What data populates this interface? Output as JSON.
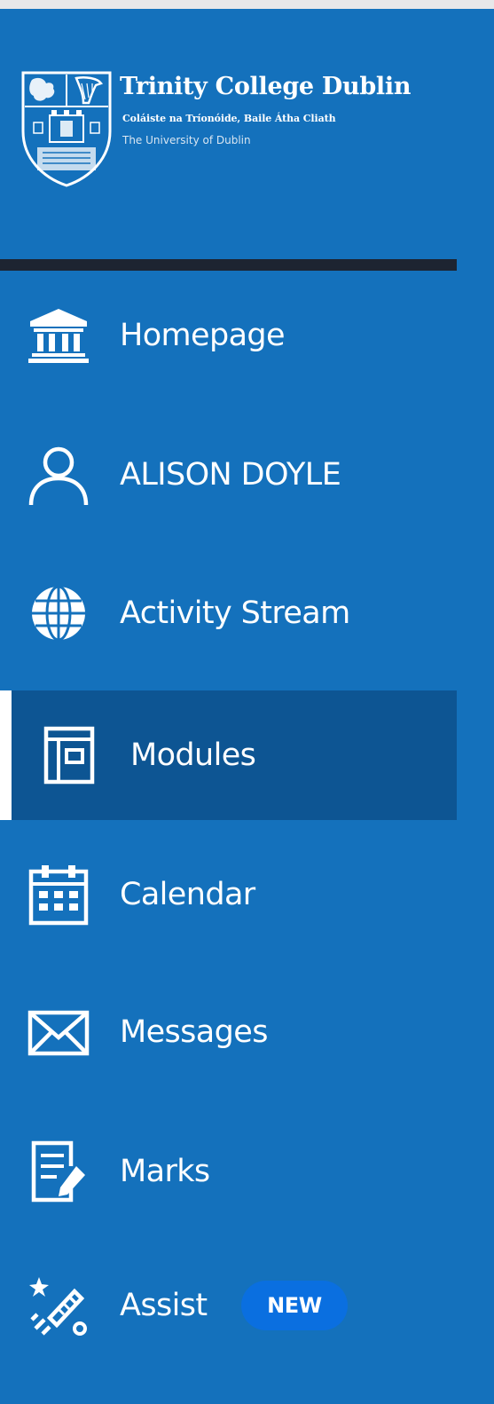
{
  "logo": {
    "title": "Trinity College Dublin",
    "subtitle_irish": "Coláiste na Tríonóide, Baile Átha Cliath",
    "subtitle_university": "The University of Dublin"
  },
  "nav": {
    "items": [
      {
        "label": "Homepage",
        "icon": "institution-icon",
        "active": false
      },
      {
        "label": "ALISON DOYLE",
        "icon": "user-icon",
        "active": false
      },
      {
        "label": "Activity Stream",
        "icon": "globe-icon",
        "active": false
      },
      {
        "label": "Modules",
        "icon": "module-book-icon",
        "active": true
      },
      {
        "label": "Calendar",
        "icon": "calendar-icon",
        "active": false
      },
      {
        "label": "Messages",
        "icon": "envelope-icon",
        "active": false
      },
      {
        "label": "Marks",
        "icon": "document-pencil-icon",
        "active": false
      },
      {
        "label": "Assist",
        "icon": "magic-wand-icon",
        "active": false,
        "badge": "NEW"
      }
    ]
  },
  "colors": {
    "sidebar_bg": "#1471bc",
    "active_bg": "#0d5593",
    "active_indicator": "#ffffff",
    "divider": "#1d2431",
    "badge_bg": "#0a6fe0",
    "text": "#ffffff",
    "page_bg": "#e7e7e9"
  }
}
